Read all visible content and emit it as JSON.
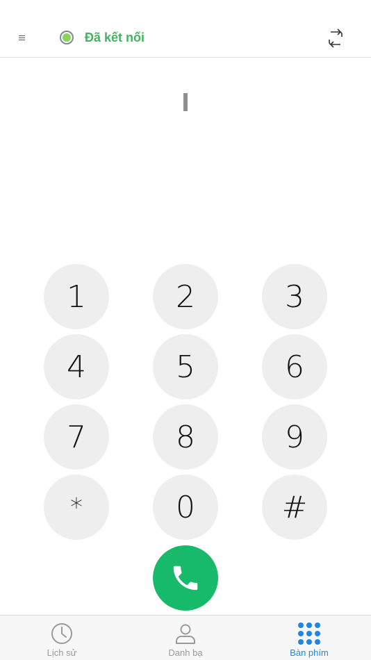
{
  "header": {
    "status_text": "Đã kết nối",
    "status_color": "#3fb55f",
    "menu_icon": "menu-icon",
    "switch_icon": "swap-icon"
  },
  "dialer": {
    "number": ""
  },
  "keypad": {
    "keys": [
      "1",
      "2",
      "3",
      "4",
      "5",
      "6",
      "7",
      "8",
      "9",
      "*",
      "0",
      "#"
    ],
    "call_icon": "phone-icon",
    "call_color": "#17b96a"
  },
  "tabbar": {
    "tabs": [
      {
        "label": "Lịch sử",
        "icon": "clock-icon",
        "active": false
      },
      {
        "label": "Danh bạ",
        "icon": "person-icon",
        "active": false
      },
      {
        "label": "Bàn phím",
        "icon": "keypad-grid-icon",
        "active": true
      }
    ],
    "active_color": "#1f86e3"
  }
}
